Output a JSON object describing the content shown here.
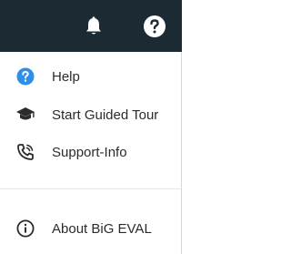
{
  "topbar": {
    "icons": [
      "bell-icon",
      "help-circle-icon"
    ],
    "background": "#1c2b33"
  },
  "menu": {
    "items": [
      {
        "label": "Help",
        "icon": "help-circle-icon",
        "icon_color": "#2f8ee6"
      },
      {
        "label": "Start Guided Tour",
        "icon": "graduation-cap-icon"
      },
      {
        "label": "Support-Info",
        "icon": "phone-icon"
      },
      {
        "label": "About BiG EVAL",
        "icon": "info-circle-icon"
      }
    ]
  }
}
